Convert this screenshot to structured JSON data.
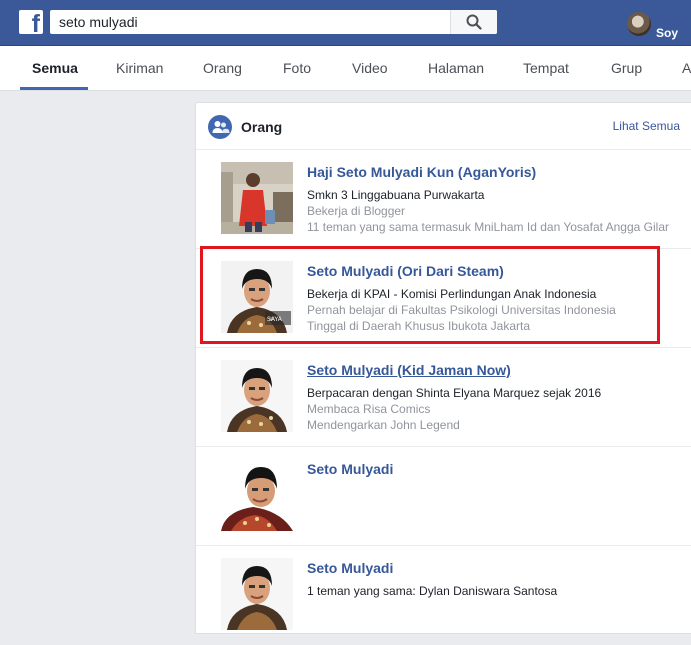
{
  "search": {
    "value": "seto mulyadi"
  },
  "user": {
    "name": "Soy"
  },
  "tabs": [
    {
      "label": "Semua"
    },
    {
      "label": "Kiriman"
    },
    {
      "label": "Orang"
    },
    {
      "label": "Foto"
    },
    {
      "label": "Video"
    },
    {
      "label": "Halaman"
    },
    {
      "label": "Tempat"
    },
    {
      "label": "Grup"
    },
    {
      "label": "A"
    }
  ],
  "section": {
    "title": "Orang",
    "see_all": "Lihat Semua"
  },
  "results": [
    {
      "name": "Haji Seto Mulyadi Kun (AganYoris)",
      "line1": "Smkn 3 Linggabuana Purwakarta",
      "line2": "Bekerja di Blogger",
      "line3": "11 teman yang sama termasuk MniLham Id dan Yosafat Angga Gilar"
    },
    {
      "name": "Seto Mulyadi (Ori Dari Steam)",
      "line1": "Bekerja di KPAI - Komisi Perlindungan Anak Indonesia",
      "line2": "Pernah belajar di Fakultas Psikologi Universitas Indonesia",
      "line3": "Tinggal di Daerah Khusus Ibukota Jakarta"
    },
    {
      "name": "Seto Mulyadi (Kid Jaman Now)",
      "line1": "Berpacaran dengan Shinta Elyana Marquez sejak 2016",
      "line2": "Membaca Risa Comics",
      "line3": "Mendengarkan John Legend"
    },
    {
      "name": "Seto Mulyadi",
      "line1": "",
      "line2": "",
      "line3": ""
    },
    {
      "name": "Seto Mulyadi",
      "line1": "1 teman yang sama: Dylan Daniswara Santosa",
      "line2": "",
      "line3": ""
    }
  ],
  "colors": {
    "brand": "#3b5998",
    "link": "#365899",
    "highlight": "#e0161e"
  }
}
